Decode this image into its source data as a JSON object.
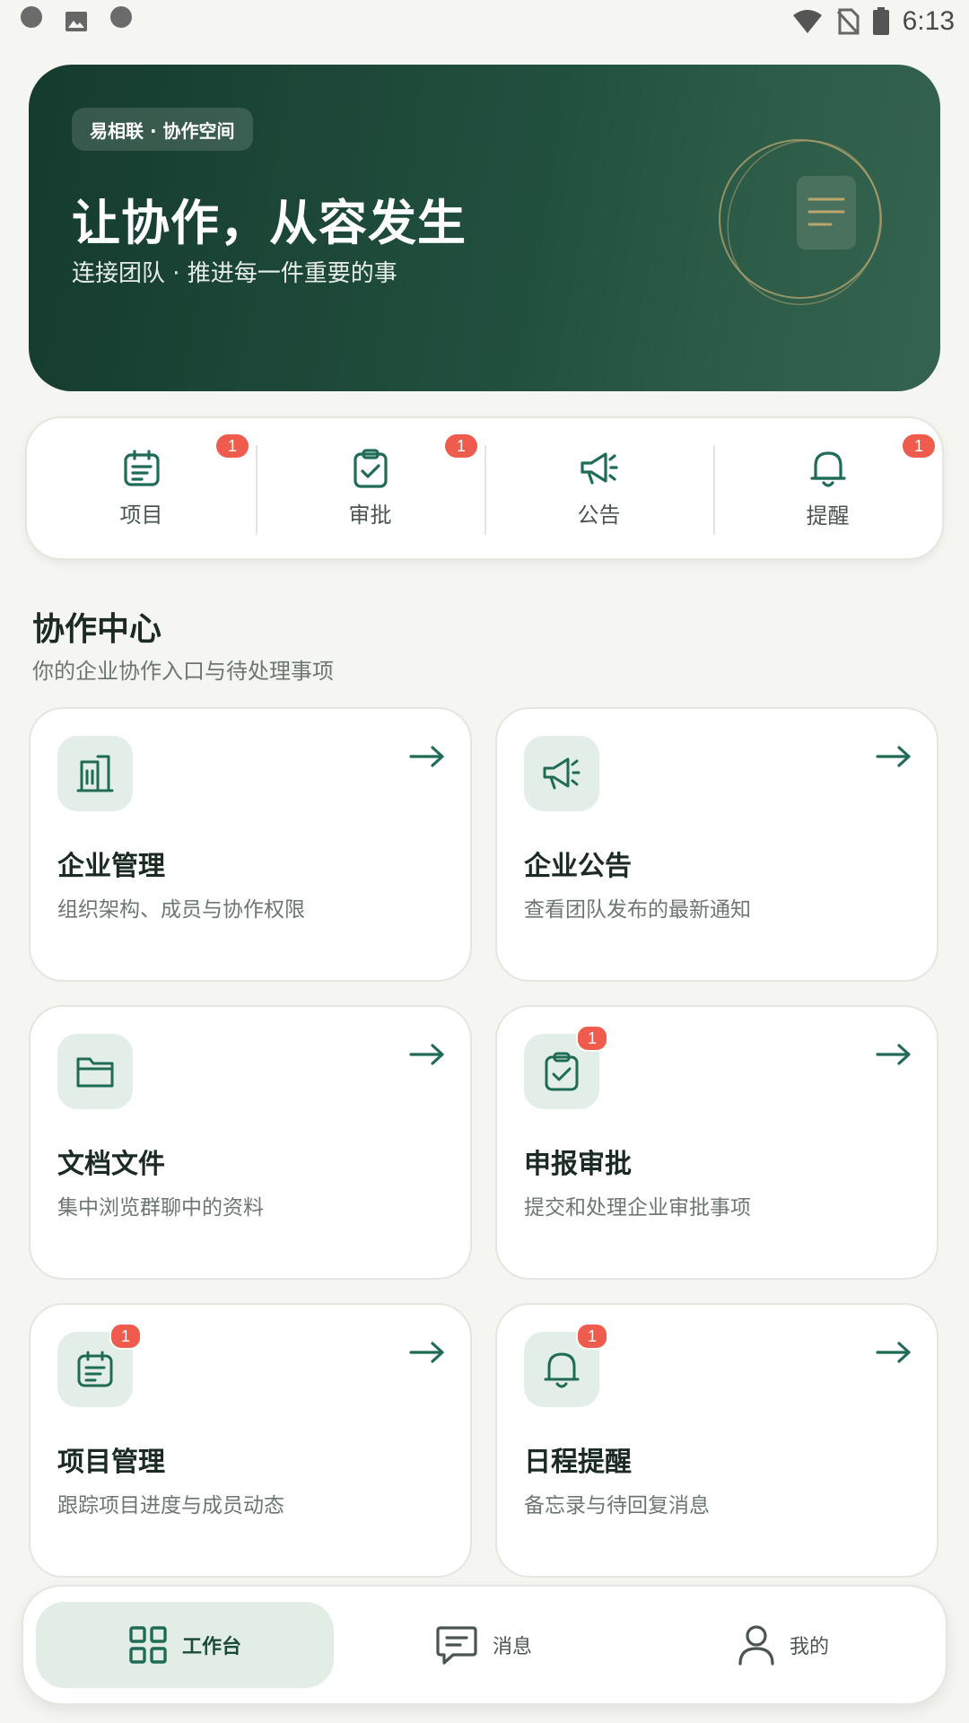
{
  "status_bar": {
    "time": "6:13",
    "left_icons": [
      "app-logo-icon",
      "image-icon",
      "app-logo-icon"
    ],
    "right_icons": [
      "wifi-icon",
      "no-sim-icon",
      "battery-icon"
    ]
  },
  "hero": {
    "tag": "易相联 · 协作空间",
    "title": "让协作，从容发生",
    "subtitle": "连接团队 · 推进每一件重要的事"
  },
  "quick_bar": {
    "items": [
      {
        "label": "项目",
        "icon": "calendar-list-icon",
        "badge": "1"
      },
      {
        "label": "审批",
        "icon": "clipboard-check-icon",
        "badge": "1"
      },
      {
        "label": "公告",
        "icon": "megaphone-icon",
        "badge": ""
      },
      {
        "label": "提醒",
        "icon": "bell-icon",
        "badge": "1"
      }
    ]
  },
  "section": {
    "title": "协作中心",
    "subtitle": "你的企业协作入口与待处理事项"
  },
  "cards": [
    {
      "title": "企业管理",
      "desc": "组织架构、成员与协作权限",
      "icon": "building-icon",
      "badge": ""
    },
    {
      "title": "企业公告",
      "desc": "查看团队发布的最新通知",
      "icon": "megaphone-icon",
      "badge": ""
    },
    {
      "title": "文档文件",
      "desc": "集中浏览群聊中的资料",
      "icon": "folder-icon",
      "badge": ""
    },
    {
      "title": "申报审批",
      "desc": "提交和处理企业审批事项",
      "icon": "clipboard-check-icon",
      "badge": "1"
    },
    {
      "title": "项目管理",
      "desc": "跟踪项目进度与成员动态",
      "icon": "calendar-list-icon",
      "badge": "1"
    },
    {
      "title": "日程提醒",
      "desc": "备忘录与待回复消息",
      "icon": "bell-icon",
      "badge": "1"
    }
  ],
  "bottom_nav": {
    "items": [
      {
        "label": "工作台",
        "icon": "grid-icon",
        "active": true
      },
      {
        "label": "消息",
        "icon": "message-icon",
        "active": false
      },
      {
        "label": "我的",
        "icon": "user-icon",
        "active": false
      }
    ]
  },
  "colors": {
    "brand": "#1f6b55",
    "hero_dark": "#153b2e",
    "badge": "#ef5b4c",
    "icon_bg": "#e3eee8",
    "page_bg": "#f5f5f1"
  }
}
